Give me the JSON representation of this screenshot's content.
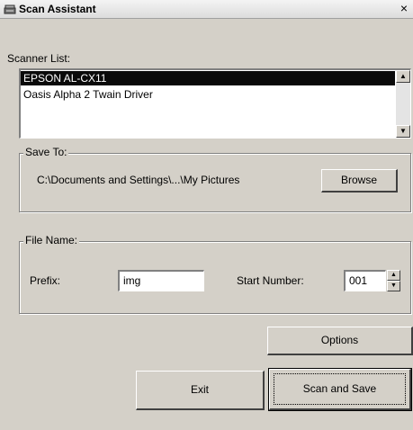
{
  "window": {
    "title": "Scan Assistant",
    "close_symbol": "×"
  },
  "scanner_list": {
    "label": "Scanner List:",
    "items": [
      {
        "label": "EPSON AL-CX11",
        "selected": true
      },
      {
        "label": "Oasis Alpha 2 Twain Driver",
        "selected": false
      }
    ]
  },
  "save_to": {
    "group_label": "Save To:",
    "path": "C:\\Documents and Settings\\...\\My Pictures",
    "browse_label": "Browse"
  },
  "file_name": {
    "group_label": "File Name:",
    "prefix_label": "Prefix:",
    "prefix_value": "img",
    "start_number_label": "Start Number:",
    "start_number_value": "001"
  },
  "buttons": {
    "options_label": "Options",
    "exit_label": "Exit",
    "scan_save_label": "Scan and Save"
  },
  "icons": {
    "title": "scanner-icon",
    "scroll_up": "scroll-up-arrow-icon",
    "scroll_down": "scroll-down-arrow-icon",
    "spin_up": "spin-up-arrow-icon",
    "spin_down": "spin-down-arrow-icon"
  }
}
